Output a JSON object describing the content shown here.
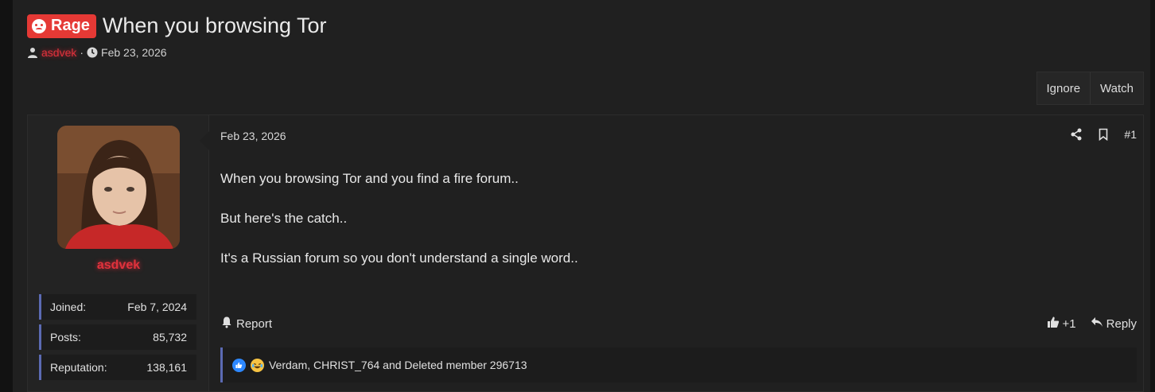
{
  "thread": {
    "prefix": "Rage",
    "title": "When you browsing Tor",
    "author": "asdvek",
    "date": "Feb 23, 2026"
  },
  "buttons": {
    "ignore": "Ignore",
    "watch": "Watch"
  },
  "post": {
    "date": "Feb 23, 2026",
    "number": "#1",
    "body": [
      "When you browsing Tor and you find a fire forum..",
      "But here's the catch..",
      "It's a Russian forum so you don't understand a single word.."
    ],
    "report": "Report",
    "like_count": "+1",
    "reply": "Reply",
    "reactions_text": "Verdam, CHRIST_764 and Deleted member 296713"
  },
  "user": {
    "name": "asdvek",
    "stats": [
      {
        "label": "Joined:",
        "value": "Feb 7, 2024"
      },
      {
        "label": "Posts:",
        "value": "85,732"
      },
      {
        "label": "Reputation:",
        "value": "138,161"
      }
    ]
  },
  "colors": {
    "prefix_bg": "#e53935",
    "username": "#e0323c",
    "stat_accent": "#5b6ab3"
  },
  "icons": {
    "prefix": "angry-face-icon",
    "author": "user-icon",
    "date": "clock-icon",
    "share": "share-icon",
    "bookmark": "bookmark-icon",
    "report": "bell-icon",
    "like": "thumbs-up-icon",
    "reply": "reply-icon"
  }
}
